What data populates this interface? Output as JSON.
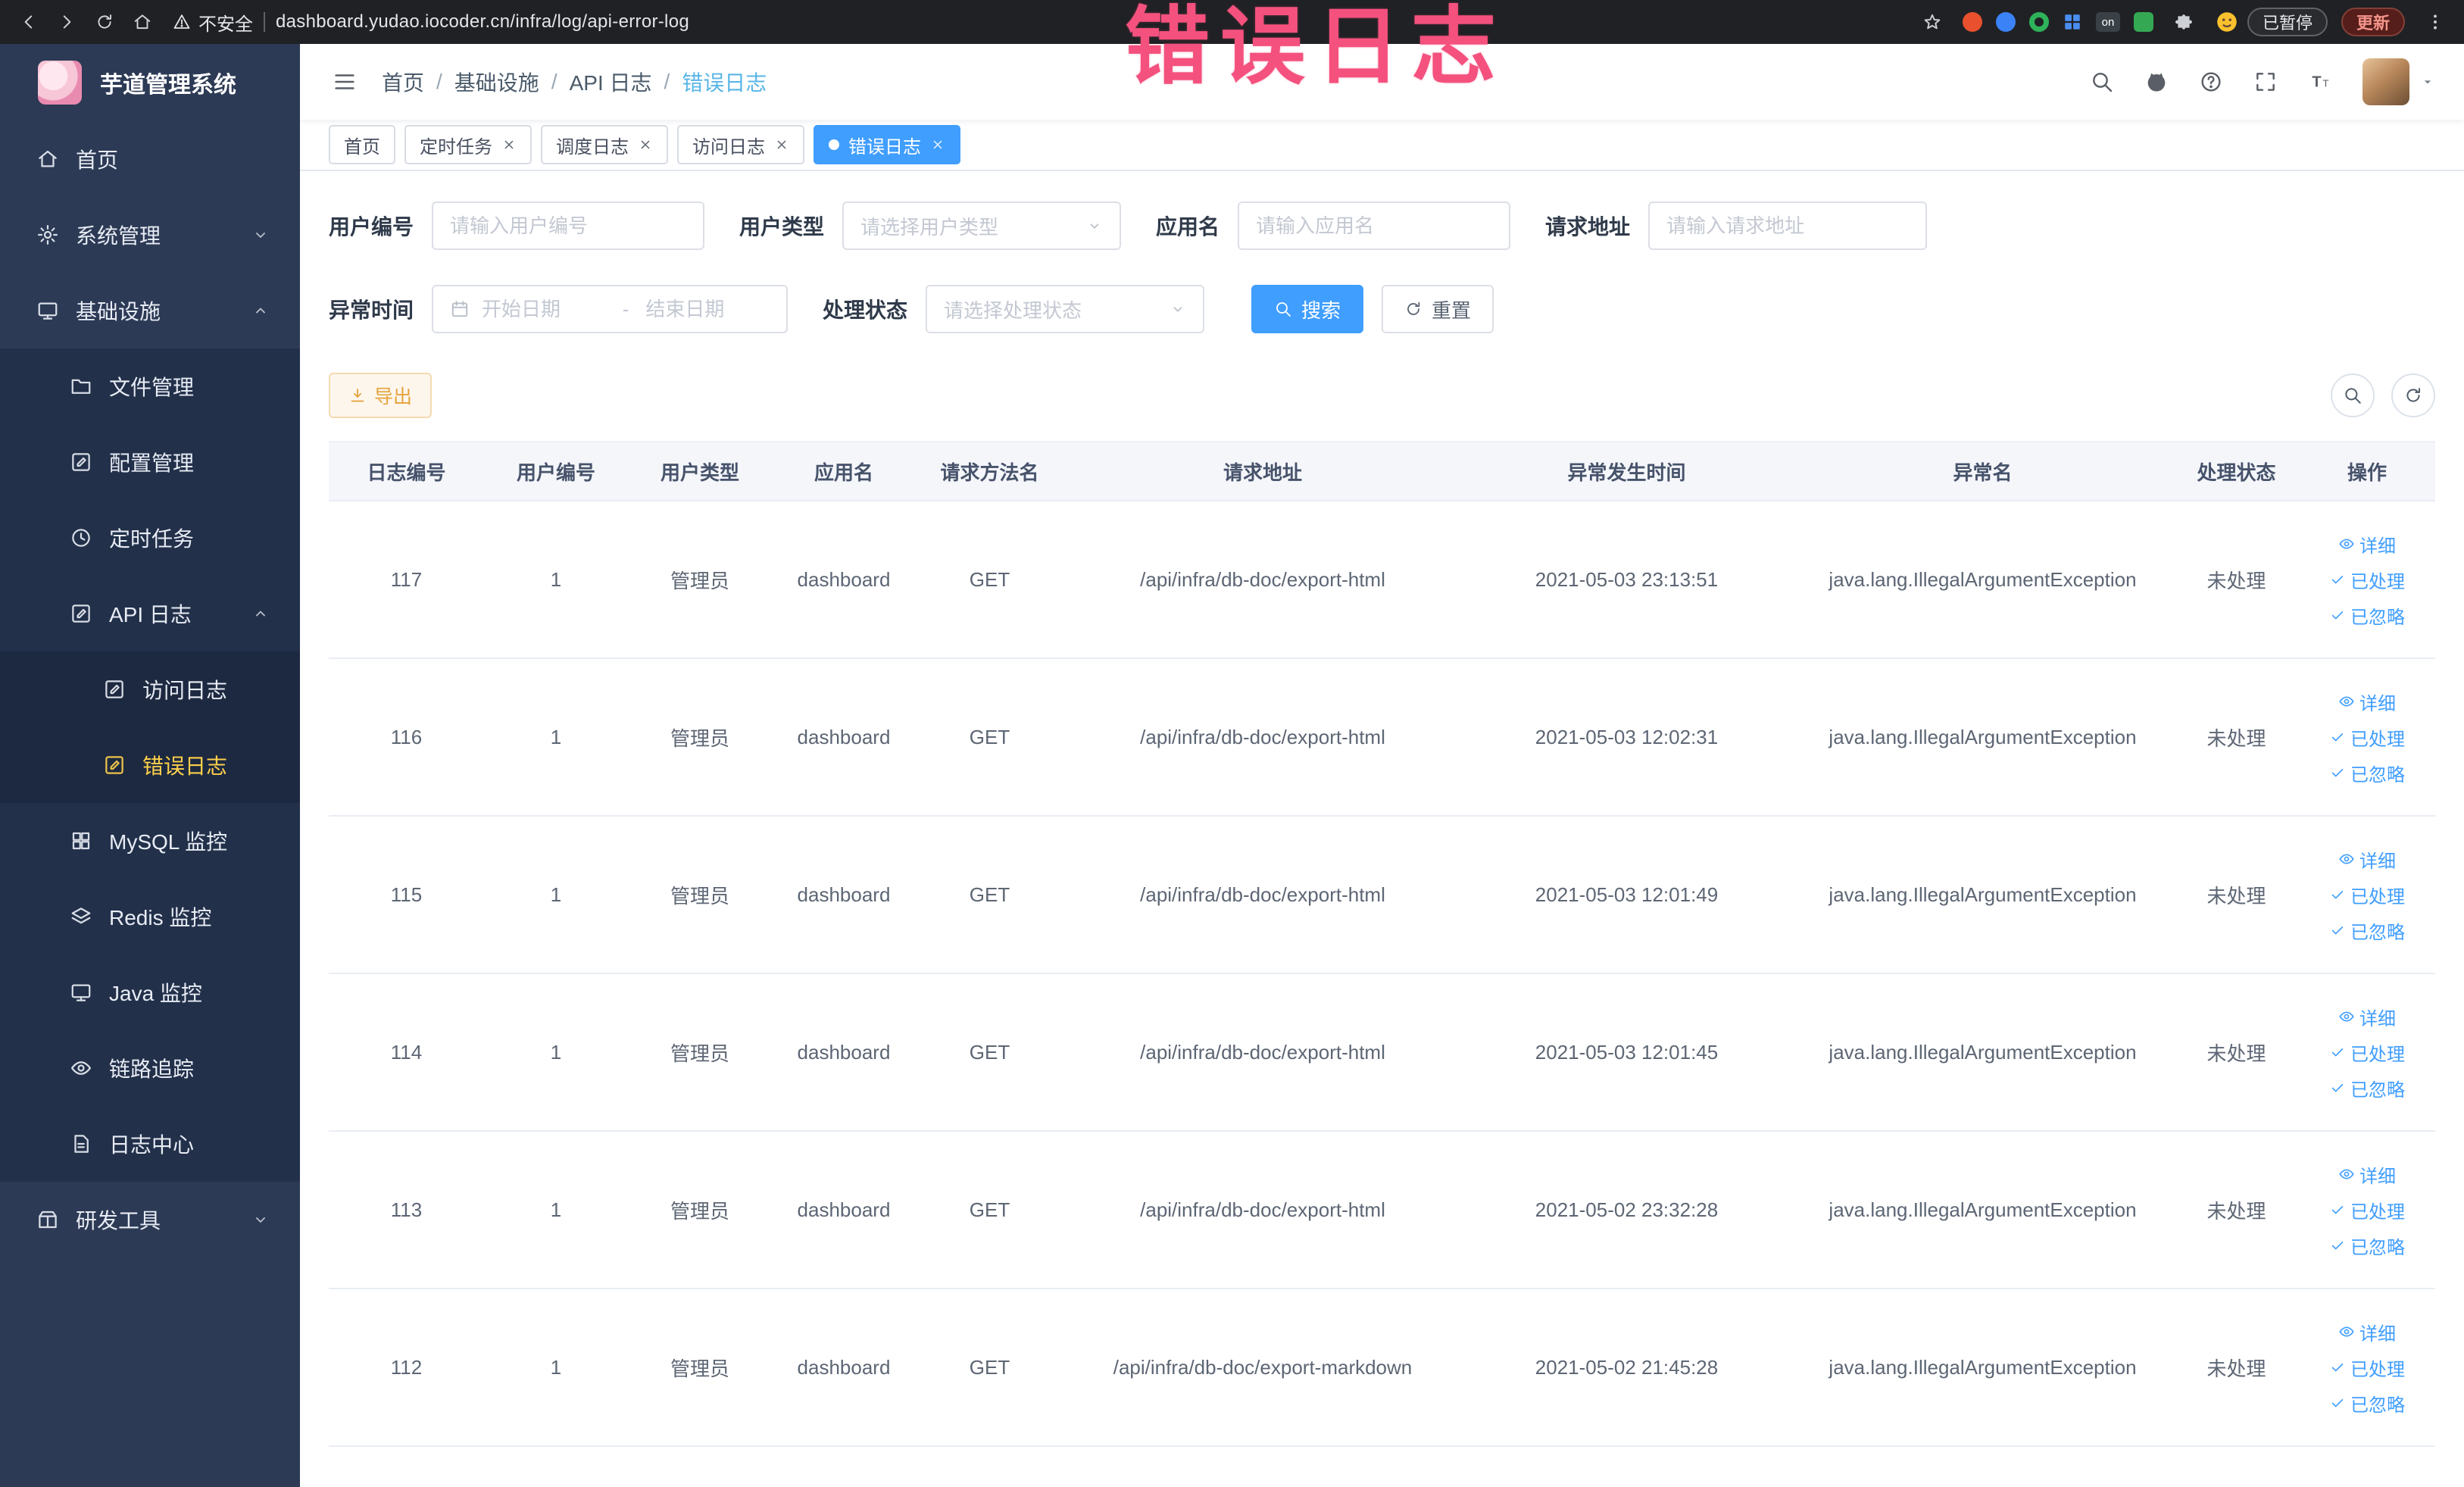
{
  "annotation": {
    "text": "错误日志"
  },
  "browser": {
    "security_label": "不安全",
    "url": "dashboard.yudao.iocoder.cn/infra/log/api-error-log",
    "paused_badge": "已暂停",
    "update_label": "更新",
    "extension_on_badge": "on"
  },
  "sidebar": {
    "logo_title": "芋道管理系统",
    "items": [
      {
        "key": "home",
        "label": "首页",
        "icon": "home-icon",
        "level": 0
      },
      {
        "key": "system",
        "label": "系统管理",
        "icon": "gear-icon",
        "level": 0,
        "chevron": "down"
      },
      {
        "key": "infra",
        "label": "基础设施",
        "icon": "infra-icon",
        "level": 0,
        "chevron": "up"
      },
      {
        "key": "file",
        "label": "文件管理",
        "icon": "folder-icon",
        "level": 1
      },
      {
        "key": "config",
        "label": "配置管理",
        "icon": "config-icon",
        "level": 1
      },
      {
        "key": "job",
        "label": "定时任务",
        "icon": "clock-icon",
        "level": 1
      },
      {
        "key": "api-log",
        "label": "API 日志",
        "icon": "edit-icon",
        "level": 1,
        "chevron": "up"
      },
      {
        "key": "access-log",
        "label": "访问日志",
        "icon": "edit-square-icon",
        "level": 2
      },
      {
        "key": "error-log",
        "label": "错误日志",
        "icon": "edit-square-icon",
        "level": 2,
        "active": true
      },
      {
        "key": "mysql",
        "label": "MySQL 监控",
        "icon": "grid-icon",
        "level": 1
      },
      {
        "key": "redis",
        "label": "Redis 监控",
        "icon": "layers-icon",
        "level": 1
      },
      {
        "key": "java",
        "label": "Java 监控",
        "icon": "monitor-icon",
        "level": 1
      },
      {
        "key": "trace",
        "label": "链路追踪",
        "icon": "eye-icon",
        "level": 1
      },
      {
        "key": "log-center",
        "label": "日志中心",
        "icon": "doc-icon",
        "level": 1
      },
      {
        "key": "dev-tools",
        "label": "研发工具",
        "icon": "toolbox-icon",
        "level": 0,
        "chevron": "down"
      }
    ]
  },
  "header": {
    "breadcrumbs": [
      "首页",
      "基础设施",
      "API 日志",
      "错误日志"
    ],
    "separator": "/"
  },
  "tabs": [
    {
      "label": "首页",
      "closable": false,
      "active": false
    },
    {
      "label": "定时任务",
      "closable": true,
      "active": false
    },
    {
      "label": "调度日志",
      "closable": true,
      "active": false
    },
    {
      "label": "访问日志",
      "closable": true,
      "active": false
    },
    {
      "label": "错误日志",
      "closable": true,
      "active": true
    }
  ],
  "filters": {
    "user_id": {
      "label": "用户编号",
      "placeholder": "请输入用户编号"
    },
    "user_type": {
      "label": "用户类型",
      "placeholder": "请选择用户类型"
    },
    "app_name": {
      "label": "应用名",
      "placeholder": "请输入应用名"
    },
    "request_url": {
      "label": "请求地址",
      "placeholder": "请输入请求地址"
    },
    "exception_time": {
      "label": "异常时间",
      "start_placeholder": "开始日期",
      "separator": "-",
      "end_placeholder": "结束日期"
    },
    "process_status": {
      "label": "处理状态",
      "placeholder": "请选择处理状态"
    },
    "search_label": "搜索",
    "reset_label": "重置"
  },
  "toolbar": {
    "export_label": "导出"
  },
  "table": {
    "columns": [
      "日志编号",
      "用户编号",
      "用户类型",
      "应用名",
      "请求方法名",
      "请求地址",
      "异常发生时间",
      "异常名",
      "处理状态",
      "操作"
    ],
    "row_actions": [
      "详细",
      "已处理",
      "已忽略"
    ],
    "rows": [
      [
        "117",
        "1",
        "管理员",
        "dashboard",
        "GET",
        "/api/infra/db-doc/export-html",
        "2021-05-03 23:13:51",
        "java.lang.IllegalArgumentException",
        "未处理"
      ],
      [
        "116",
        "1",
        "管理员",
        "dashboard",
        "GET",
        "/api/infra/db-doc/export-html",
        "2021-05-03 12:02:31",
        "java.lang.IllegalArgumentException",
        "未处理"
      ],
      [
        "115",
        "1",
        "管理员",
        "dashboard",
        "GET",
        "/api/infra/db-doc/export-html",
        "2021-05-03 12:01:49",
        "java.lang.IllegalArgumentException",
        "未处理"
      ],
      [
        "114",
        "1",
        "管理员",
        "dashboard",
        "GET",
        "/api/infra/db-doc/export-html",
        "2021-05-03 12:01:45",
        "java.lang.IllegalArgumentException",
        "未处理"
      ],
      [
        "113",
        "1",
        "管理员",
        "dashboard",
        "GET",
        "/api/infra/db-doc/export-html",
        "2021-05-02 23:32:28",
        "java.lang.IllegalArgumentException",
        "未处理"
      ],
      [
        "112",
        "1",
        "管理员",
        "dashboard",
        "GET",
        "/api/infra/db-doc/export-markdown",
        "2021-05-02 21:45:28",
        "java.lang.IllegalArgumentException",
        "未处理"
      ]
    ]
  }
}
